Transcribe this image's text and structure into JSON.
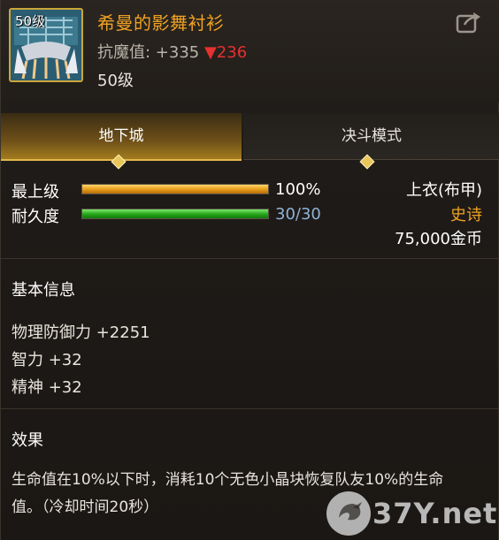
{
  "item": {
    "level_badge": "50级",
    "name": "希曼的影舞衬衫",
    "stat_label": "抗魔值: +335",
    "stat_down": "▼236",
    "level": "50级"
  },
  "icons": {
    "share": "share-icon",
    "tab_marker": "diamond-icon"
  },
  "tabs": [
    {
      "label": "地下城",
      "active": true
    },
    {
      "label": "决斗模式",
      "active": false
    }
  ],
  "bars": {
    "max_level": {
      "label": "最上级",
      "value": "100%",
      "fraction": 1.0
    },
    "durability": {
      "label": "耐久度",
      "value": "30/30",
      "fraction": 1.0
    }
  },
  "info": {
    "slot": "上衣(布甲)",
    "rarity": "史诗",
    "price": "75,000金币"
  },
  "basic": {
    "title": "基本信息",
    "stats": [
      "物理防御力 +2251",
      "智力 +32",
      "精神 +32"
    ]
  },
  "effect": {
    "title": "效果",
    "text": "生命值在10%以下时，消耗10个无色小晶块恢复队友10%的生命值。（冷却时间20秒）"
  },
  "watermark": {
    "text": "37Y.net"
  },
  "colors": {
    "accent_gold": "#f0a223",
    "down_red": "#e53131",
    "value_blue": "#8fb3d9"
  }
}
